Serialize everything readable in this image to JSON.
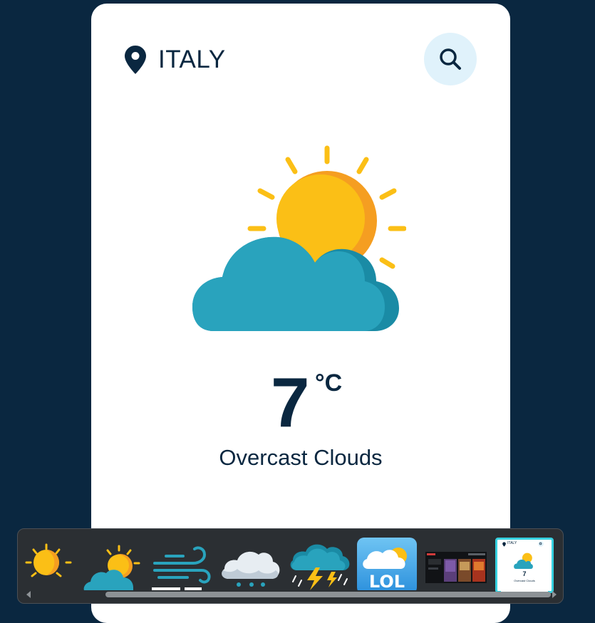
{
  "location": {
    "name": "ITALY",
    "icon": "map-pin-icon"
  },
  "search": {
    "icon": "search-icon"
  },
  "weather": {
    "icon": "sun-behind-cloud-icon",
    "temperature": "7",
    "unit": "°C",
    "description": "Overcast Clouds"
  },
  "thumbnails": [
    {
      "name": "sun-thumbnail"
    },
    {
      "name": "partly-cloudy-thumbnail"
    },
    {
      "name": "wind-thumbnail"
    },
    {
      "name": "snow-cloud-thumbnail"
    },
    {
      "name": "thunderstorm-thumbnail"
    },
    {
      "name": "app-icon-thumbnail",
      "label": "LOL"
    },
    {
      "name": "dark-app-screenshot-thumbnail"
    },
    {
      "name": "weather-app-screenshot-thumbnail",
      "selected": true,
      "mini_location": "ITALY",
      "mini_temp": "7",
      "mini_desc": "Overcast Clouds"
    }
  ],
  "colors": {
    "background": "#0a2740",
    "card": "#ffffff",
    "text": "#0a2740",
    "search_bg": "#e0f2fb",
    "sun": "#fbbf16",
    "sun_shade": "#f59e21",
    "cloud": "#29a3bd",
    "cloud_shade": "#1a8ba5",
    "selected_border": "#36d1e0"
  }
}
